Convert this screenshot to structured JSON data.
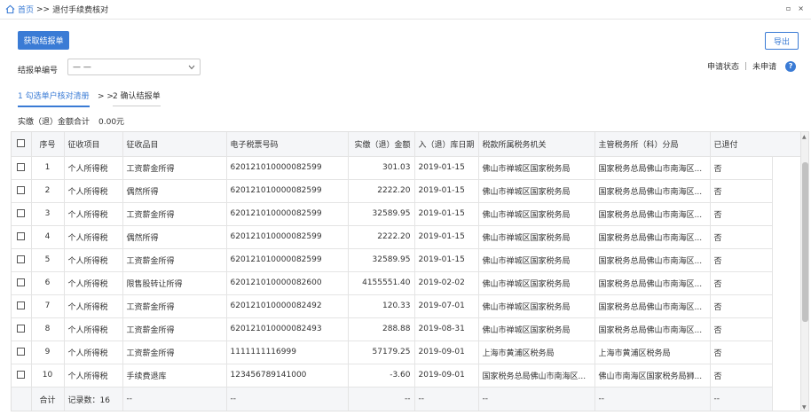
{
  "breadcrumb": {
    "home": "首页",
    "sep": ">>",
    "current": "退付手续费核对"
  },
  "window": {
    "restore": "▫",
    "close": "×"
  },
  "toolbar": {
    "fetch_label": "获取结报单",
    "export_label": "导出"
  },
  "form": {
    "report_no_label": "结报单编号",
    "report_no_value": "— —"
  },
  "status": {
    "label": "申请状态",
    "divider": "|",
    "value": "未申请",
    "help": "?"
  },
  "steps": {
    "step1": "1 勾选单户核对清册",
    "arrow": "> >",
    "step2": "2 确认结报单"
  },
  "summary": {
    "label": "实缴（退）金额合计",
    "value": "0.00元"
  },
  "table": {
    "headers": [
      "序号",
      "征收项目",
      "征收品目",
      "电子税票号码",
      "实缴（退）金额",
      "入（退）库日期",
      "税款所属税务机关",
      "主管税务所（科）分局",
      "已退付"
    ],
    "rows": [
      [
        "1",
        "个人所得税",
        "工资薪金所得",
        "620121010000082599",
        "301.03",
        "2019-01-15",
        "佛山市禅城区国家税务局",
        "国家税务总局佛山市南海区...",
        "否"
      ],
      [
        "2",
        "个人所得税",
        "偶然所得",
        "620121010000082599",
        "2222.20",
        "2019-01-15",
        "佛山市禅城区国家税务局",
        "国家税务总局佛山市南海区...",
        "否"
      ],
      [
        "3",
        "个人所得税",
        "工资薪金所得",
        "620121010000082599",
        "32589.95",
        "2019-01-15",
        "佛山市禅城区国家税务局",
        "国家税务总局佛山市南海区...",
        "否"
      ],
      [
        "4",
        "个人所得税",
        "偶然所得",
        "620121010000082599",
        "2222.20",
        "2019-01-15",
        "佛山市禅城区国家税务局",
        "国家税务总局佛山市南海区...",
        "否"
      ],
      [
        "5",
        "个人所得税",
        "工资薪金所得",
        "620121010000082599",
        "32589.95",
        "2019-01-15",
        "佛山市禅城区国家税务局",
        "国家税务总局佛山市南海区...",
        "否"
      ],
      [
        "6",
        "个人所得税",
        "限售股转让所得",
        "620121010000082600",
        "4155551.40",
        "2019-02-02",
        "佛山市禅城区国家税务局",
        "国家税务总局佛山市南海区...",
        "否"
      ],
      [
        "7",
        "个人所得税",
        "工资薪金所得",
        "620121010000082492",
        "120.33",
        "2019-07-01",
        "佛山市禅城区国家税务局",
        "国家税务总局佛山市南海区...",
        "否"
      ],
      [
        "8",
        "个人所得税",
        "工资薪金所得",
        "620121010000082493",
        "288.88",
        "2019-08-31",
        "佛山市禅城区国家税务局",
        "国家税务总局佛山市南海区...",
        "否"
      ],
      [
        "9",
        "个人所得税",
        "工资薪金所得",
        "1111111116999",
        "57179.25",
        "2019-09-01",
        "上海市黄浦区税务局",
        "上海市黄浦区税务局",
        "否"
      ],
      [
        "10",
        "个人所得税",
        "手续费退库",
        "123456789141000",
        "-3.60",
        "2019-09-01",
        "国家税务总局佛山市南海区...",
        "佛山市南海区国家税务局狮...",
        "否"
      ]
    ],
    "total": {
      "label": "合计",
      "records": "记录数：16",
      "dash": "--"
    }
  }
}
